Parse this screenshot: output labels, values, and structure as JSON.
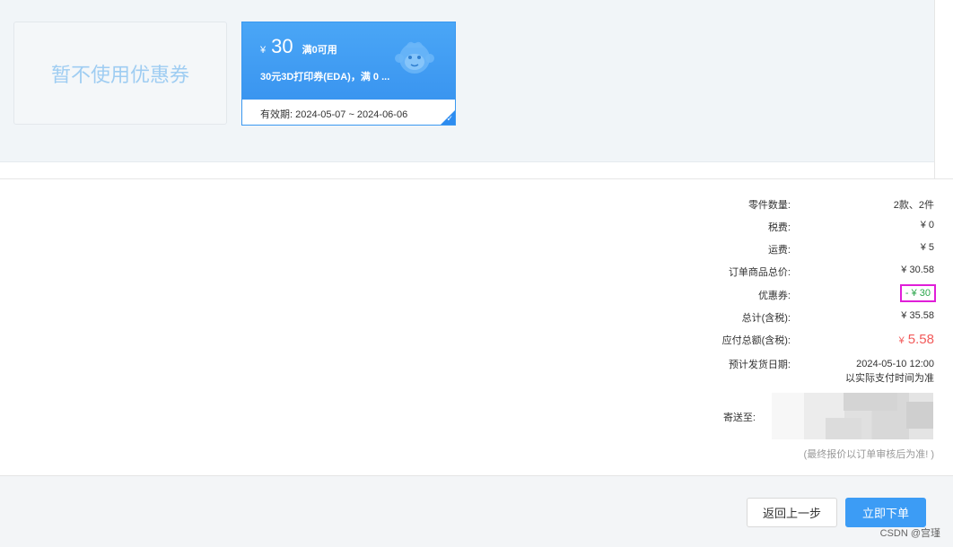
{
  "coupon_section": {
    "no_coupon_label": "暂不使用优惠券",
    "coupon": {
      "currency": "¥",
      "amount": "30",
      "condition": "满0可用",
      "description": "30元3D打印券(EDA)，满 0 ...",
      "validity_label": "有效期: ",
      "validity_range": "2024-05-07 ~ 2024-06-06",
      "selected": true,
      "mascot_icon": "monkey-mascot-icon"
    }
  },
  "summary": {
    "parts_count": {
      "label": "零件数量:",
      "value": "2款、2件"
    },
    "tax": {
      "label": "税费:",
      "value": "¥ 0"
    },
    "shipping": {
      "label": "运费:",
      "value": "¥ 5"
    },
    "order_total": {
      "label": "订单商品总价:",
      "value": "¥ 30.58"
    },
    "coupon_discount": {
      "label": "优惠券:",
      "value": "- ¥ 30"
    },
    "total_with_tax": {
      "label": "总计(含税):",
      "value": "¥ 35.58"
    },
    "payable": {
      "label": "应付总额(含税):",
      "currency": "¥",
      "value": "5.58"
    },
    "ship_date": {
      "label": "预计发货日期:",
      "value": "2024-05-10 12:00",
      "note": "以实际支付时间为准"
    },
    "ship_to": {
      "label": "寄送至:"
    },
    "final_note": "(最终报价以订单审核后为准! )"
  },
  "footer": {
    "back_label": "返回上一步",
    "submit_label": "立即下单",
    "watermark": "CSDN @宫瑾"
  },
  "colors": {
    "accent": "#3c9cf5",
    "discount": "#2aa54a",
    "payable": "#f25a5a",
    "highlight_box": "#e01ed8"
  }
}
